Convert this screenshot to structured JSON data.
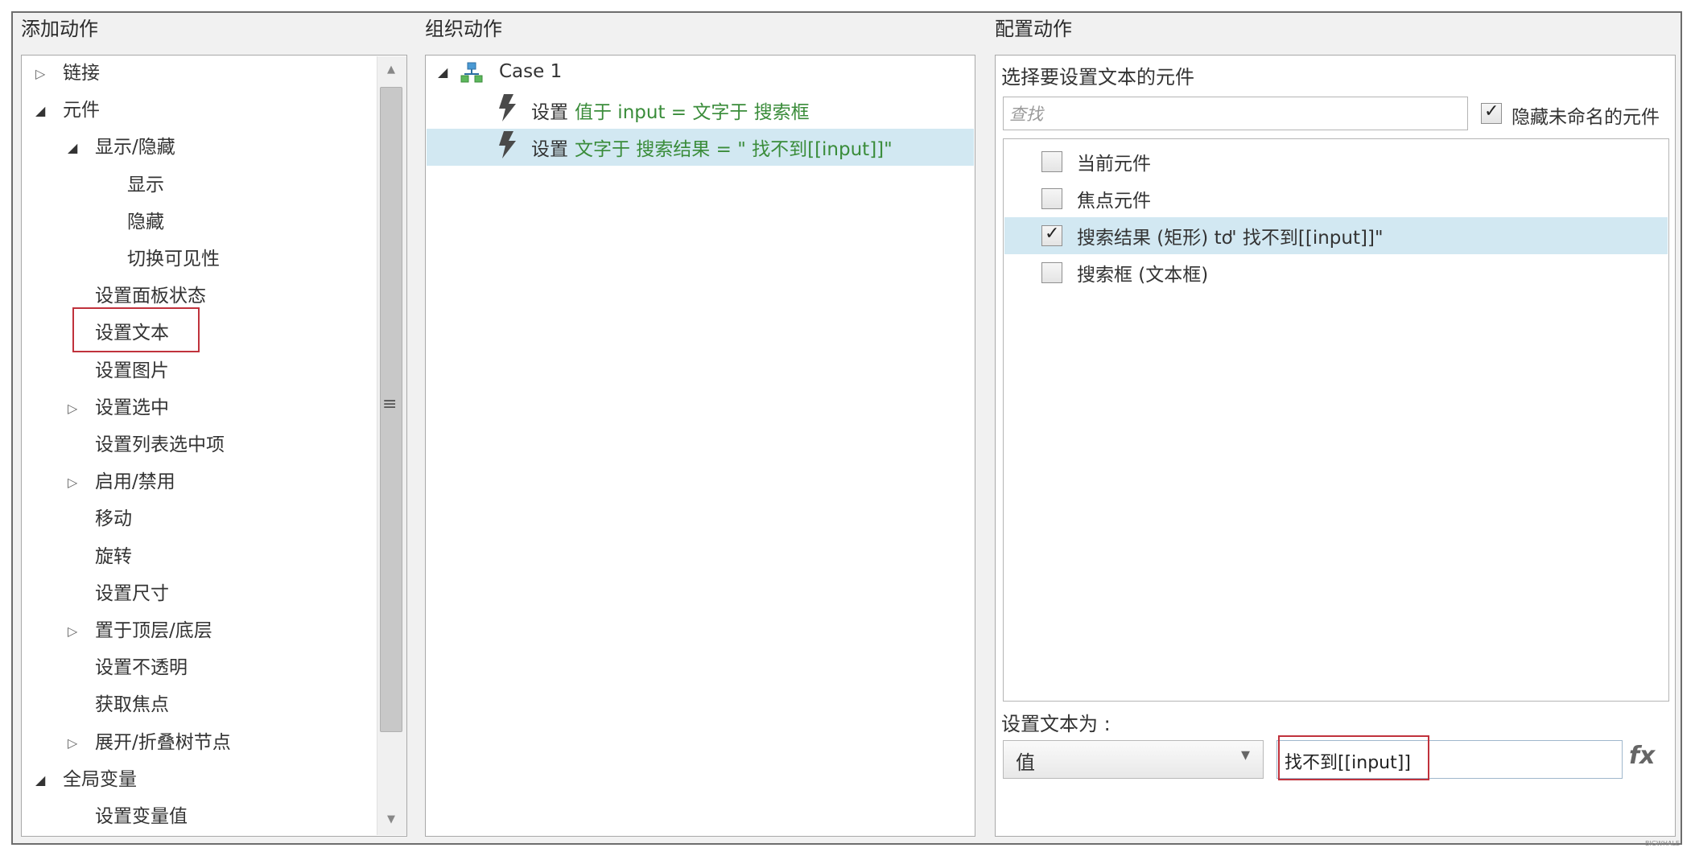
{
  "sections": {
    "add_actions": "添加动作",
    "organize_actions": "组织动作",
    "configure_actions": "配置动作"
  },
  "tree": [
    {
      "label": "链接",
      "arrow": "▷",
      "level": 0
    },
    {
      "label": "元件",
      "arrow": "◢",
      "level": 0
    },
    {
      "label": "显示/隐藏",
      "arrow": "◢",
      "level": 1
    },
    {
      "label": "显示",
      "arrow": "",
      "level": 2
    },
    {
      "label": "隐藏",
      "arrow": "",
      "level": 2
    },
    {
      "label": "切换可见性",
      "arrow": "",
      "level": 2
    },
    {
      "label": "设置面板状态",
      "arrow": "",
      "level": 1
    },
    {
      "label": "设置文本",
      "arrow": "",
      "level": 1,
      "highlighted": true
    },
    {
      "label": "设置图片",
      "arrow": "",
      "level": 1
    },
    {
      "label": "设置选中",
      "arrow": "▷",
      "level": 1
    },
    {
      "label": "设置列表选中项",
      "arrow": "",
      "level": 1
    },
    {
      "label": "启用/禁用",
      "arrow": "▷",
      "level": 1
    },
    {
      "label": "移动",
      "arrow": "",
      "level": 1
    },
    {
      "label": "旋转",
      "arrow": "",
      "level": 1
    },
    {
      "label": "设置尺寸",
      "arrow": "",
      "level": 1
    },
    {
      "label": "置于顶层/底层",
      "arrow": "▷",
      "level": 1
    },
    {
      "label": "设置不透明",
      "arrow": "",
      "level": 1
    },
    {
      "label": "获取焦点",
      "arrow": "",
      "level": 1
    },
    {
      "label": "展开/折叠树节点",
      "arrow": "▷",
      "level": 1
    },
    {
      "label": "全局变量",
      "arrow": "◢",
      "level": 0
    },
    {
      "label": "设置变量值",
      "arrow": "",
      "level": 1
    }
  ],
  "scrollbar": {
    "up": "▲",
    "down": "▼",
    "grip": "≡"
  },
  "organize": {
    "case_arrow": "◢",
    "case_label": "Case 1",
    "actions": [
      {
        "verb": "设置",
        "detail": "值于 input = 文字于 搜索框",
        "selected": false
      },
      {
        "verb": "设置",
        "detail": "文字于 搜索结果 = \" 找不到[[input]]\"",
        "selected": true
      }
    ]
  },
  "configure": {
    "select_title": "选择要设置文本的元件",
    "search_placeholder": "查找",
    "hide_unnamed_label": "隐藏未命名的元件",
    "hide_unnamed_checked": true,
    "widgets": [
      {
        "name": "当前元件",
        "detail": "",
        "checked": false,
        "selected": false
      },
      {
        "name": "焦点元件",
        "detail": "",
        "checked": false,
        "selected": false
      },
      {
        "name": "搜索结果 (矩形) to ",
        "detail": "\" 找不到[[input]]\"",
        "checked": true,
        "selected": true
      },
      {
        "name": "搜索框 (文本框)",
        "detail": "",
        "checked": false,
        "selected": false
      }
    ],
    "set_text_label": "设置文本为 :",
    "value_type": "值",
    "dropdown_arrow": "▾",
    "value_text": "找不到[[input]]",
    "fx_label": "fx"
  },
  "watermark": "BIGWHALE"
}
